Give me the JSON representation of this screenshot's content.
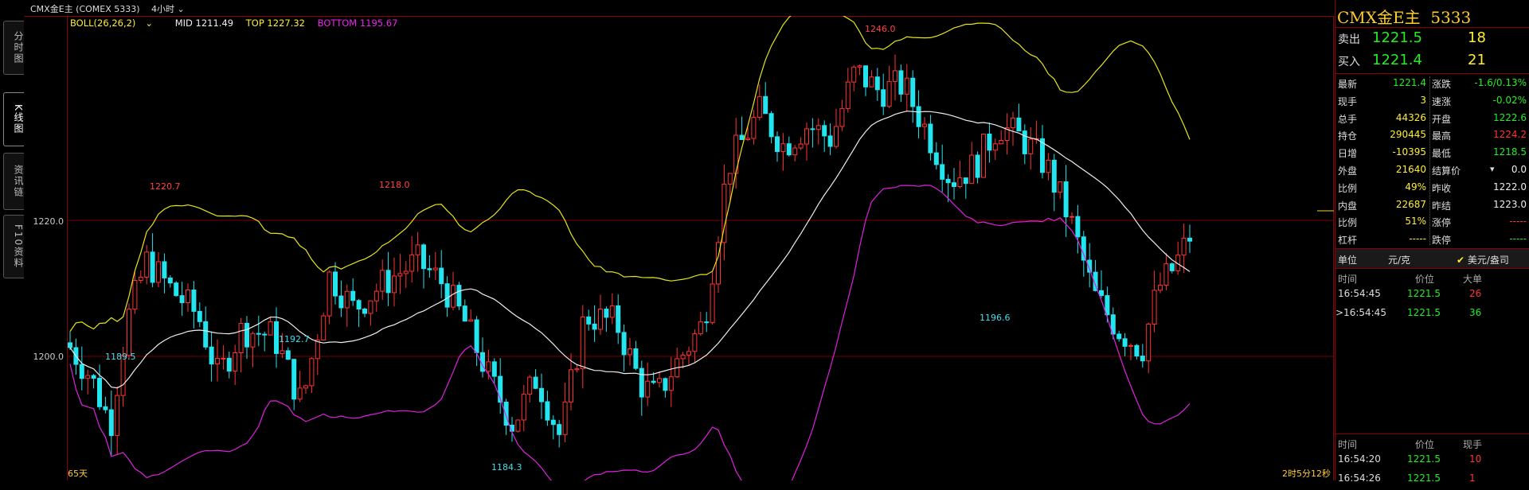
{
  "titlebar": {
    "symbol": "CMX金E主 (COMEX 5333)",
    "period": "4小时"
  },
  "tabs": [
    "分时图",
    "K线图",
    "资讯链",
    "F10资料"
  ],
  "indicator": {
    "name": "BOLL(26,26,2)",
    "mid": "MID 1211.49",
    "top": "TOP 1227.32",
    "bottom": "BOTTOM 1195.67"
  },
  "yaxis": {
    "ticks": [
      "1220.0",
      "1200.0"
    ]
  },
  "chart_annotations": {
    "high_left": "1220.7",
    "high_mid": "1218.0",
    "high_peak": "1246.0",
    "low1": "1189.5",
    "low2": "1192.7",
    "low3": "1184.3",
    "low4": "1196.6"
  },
  "footer": {
    "days": "65天",
    "countdown": "2时5分12秒"
  },
  "chart_data": {
    "type": "candlestick",
    "title": "CMX金E主 (COMEX 5333) 4小时",
    "ylim": [
      1183,
      1250
    ],
    "ticks": [
      1200.0,
      1220.0
    ],
    "boll": {
      "period": 26,
      "mid": 1211.49,
      "top": 1227.32,
      "bottom": 1195.67
    }
  },
  "panel": {
    "title": "CMX金E主",
    "code": "5333",
    "sell": {
      "label": "卖出",
      "price": "1221.5",
      "qty": "18"
    },
    "buy": {
      "label": "买入",
      "price": "1221.4",
      "qty": "21"
    },
    "stats_left": [
      {
        "label": "最新",
        "value": "1221.4",
        "color": "green"
      },
      {
        "label": "现手",
        "value": "3",
        "color": "yellow"
      },
      {
        "label": "总手",
        "value": "44326",
        "color": "yellow"
      },
      {
        "label": "持仓",
        "value": "290445",
        "color": "yellow"
      },
      {
        "label": "日增",
        "value": "-10395",
        "color": "yellow"
      },
      {
        "label": "外盘",
        "value": "21640",
        "color": "yellow"
      },
      {
        "label": "比例",
        "value": "49%",
        "color": "yellow"
      },
      {
        "label": "内盘",
        "value": "22687",
        "color": "yellow"
      },
      {
        "label": "比例",
        "value": "51%",
        "color": "yellow"
      },
      {
        "label": "杠杆",
        "value": "-----",
        "color": "yellow"
      }
    ],
    "stats_right": [
      {
        "label": "涨跌",
        "value": "-1.6/0.13%",
        "color": "green"
      },
      {
        "label": "速涨",
        "value": "-0.02%",
        "color": "green"
      },
      {
        "label": "开盘",
        "value": "1222.6",
        "color": "green"
      },
      {
        "label": "最高",
        "value": "1224.2",
        "color": "red"
      },
      {
        "label": "最低",
        "value": "1218.5",
        "color": "green"
      },
      {
        "label": "结算价",
        "value": "0.0",
        "color": "white"
      },
      {
        "label": "昨收",
        "value": "1222.0",
        "color": "white"
      },
      {
        "label": "昨结",
        "value": "1223.0",
        "color": "white"
      },
      {
        "label": "涨停",
        "value": "-----",
        "color": "red"
      },
      {
        "label": "跌停",
        "value": "-----",
        "color": "green"
      }
    ],
    "unit_label": "单位",
    "unit_value": "元/克",
    "unit_option": "美元/盎司",
    "big_orders": {
      "headers": [
        "时间",
        "价位",
        "大单"
      ],
      "rows": [
        {
          "time": "16:54:45",
          "price": "1221.5",
          "qty": "26",
          "color": "red"
        },
        {
          "time": "16:54:45",
          "price": "1221.5",
          "qty": "36",
          "color": "green"
        }
      ]
    },
    "ticks": {
      "headers": [
        "时间",
        "价位",
        "现手"
      ],
      "rows": [
        {
          "time": "16:54:20",
          "price": "1221.5",
          "qty": "10",
          "color": "red"
        },
        {
          "time": "16:54:26",
          "price": "1221.5",
          "qty": "1",
          "color": "red"
        }
      ]
    }
  }
}
